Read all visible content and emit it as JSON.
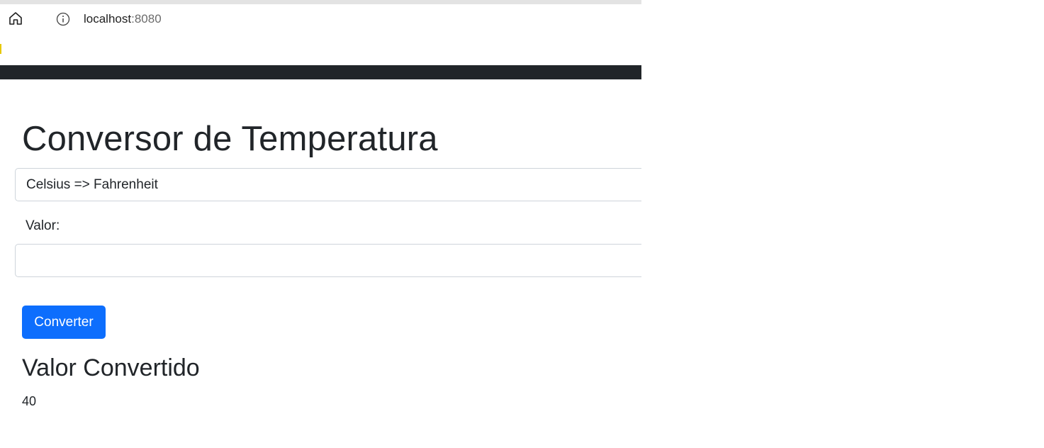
{
  "browser": {
    "url_host": "localhost",
    "url_port": ":8080",
    "icons": {
      "home": "home-icon",
      "info": "info-icon"
    }
  },
  "page": {
    "title": "Conversor de Temperatura",
    "conversion_select": {
      "selected": "Celsius => Fahrenheit"
    },
    "value_label": "Valor:",
    "value_input": {
      "value": "",
      "placeholder": ""
    },
    "convert_button_label": "Converter",
    "result_heading": "Valor Convertido",
    "result_value": "40"
  },
  "colors": {
    "primary_button": "#0d6efd",
    "navbar": "#212529",
    "text": "#212529",
    "border": "#ced4da"
  }
}
